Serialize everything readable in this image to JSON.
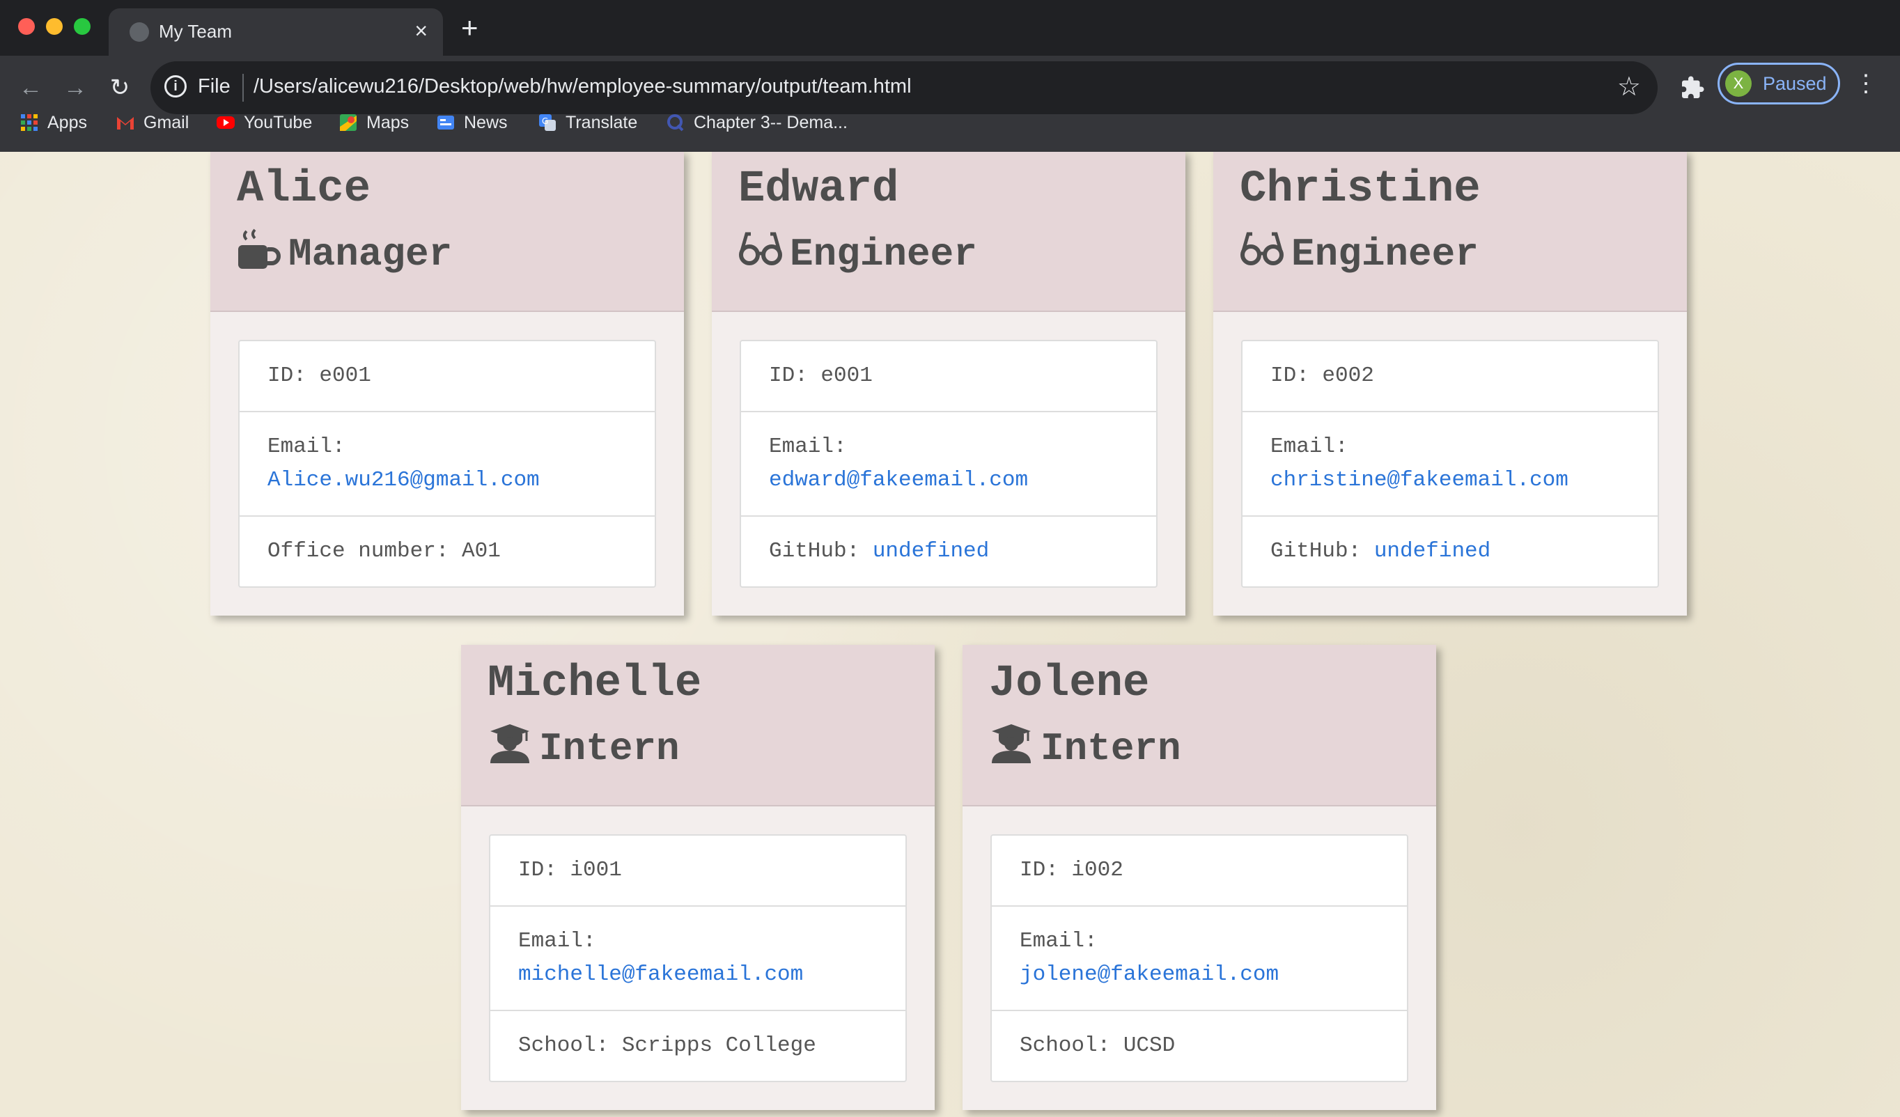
{
  "browser": {
    "tab_title": "My Team",
    "tab_close": "×",
    "new_tab": "+",
    "url_scheme": "File",
    "url": "/Users/alicewu216/Desktop/web/hw/employee-summary/output/team.html",
    "profile_initial": "X",
    "profile_label": "Paused",
    "bookmarks": [
      {
        "label": "Apps",
        "icon": "apps-grid-icon",
        "color": "#4285f4"
      },
      {
        "label": "Gmail",
        "icon": "gmail-icon",
        "color": "#ea4335"
      },
      {
        "label": "YouTube",
        "icon": "youtube-icon",
        "color": "#ff0000"
      },
      {
        "label": "Maps",
        "icon": "maps-icon",
        "color": "#34a853"
      },
      {
        "label": "News",
        "icon": "news-icon",
        "color": "#4285f4"
      },
      {
        "label": "Translate",
        "icon": "translate-icon",
        "color": "#4285f4"
      },
      {
        "label": "Chapter 3-- Dema...",
        "icon": "quizlet-icon",
        "color": "#4257b2"
      }
    ]
  },
  "employees": [
    {
      "name": "Alice",
      "role": "Manager",
      "role_icon": "coffee-mug-icon",
      "id_label": "ID: e001",
      "email_label": "Email:",
      "email": "Alice.wu216@gmail.com",
      "extra_label": "Office number: A01",
      "extra_value": ""
    },
    {
      "name": "Edward",
      "role": "Engineer",
      "role_icon": "glasses-icon",
      "id_label": "ID: e001",
      "email_label": "Email:",
      "email": "edward@fakeemail.com",
      "extra_label": "GitHub: ",
      "extra_value": "undefined"
    },
    {
      "name": "Christine",
      "role": "Engineer",
      "role_icon": "glasses-icon",
      "id_label": "ID: e002",
      "email_label": "Email:",
      "email": "christine@fakeemail.com",
      "extra_label": "GitHub: ",
      "extra_value": "undefined"
    },
    {
      "name": "Michelle",
      "role": "Intern",
      "role_icon": "graduate-icon",
      "id_label": "ID: i001",
      "email_label": "Email:",
      "email": "michelle@fakeemail.com",
      "extra_label": "School: Scripps College",
      "extra_value": ""
    },
    {
      "name": "Jolene",
      "role": "Intern",
      "role_icon": "graduate-icon",
      "id_label": "ID: i002",
      "email_label": "Email:",
      "email": "jolene@fakeemail.com",
      "extra_label": "School: UCSD",
      "extra_value": ""
    }
  ]
}
